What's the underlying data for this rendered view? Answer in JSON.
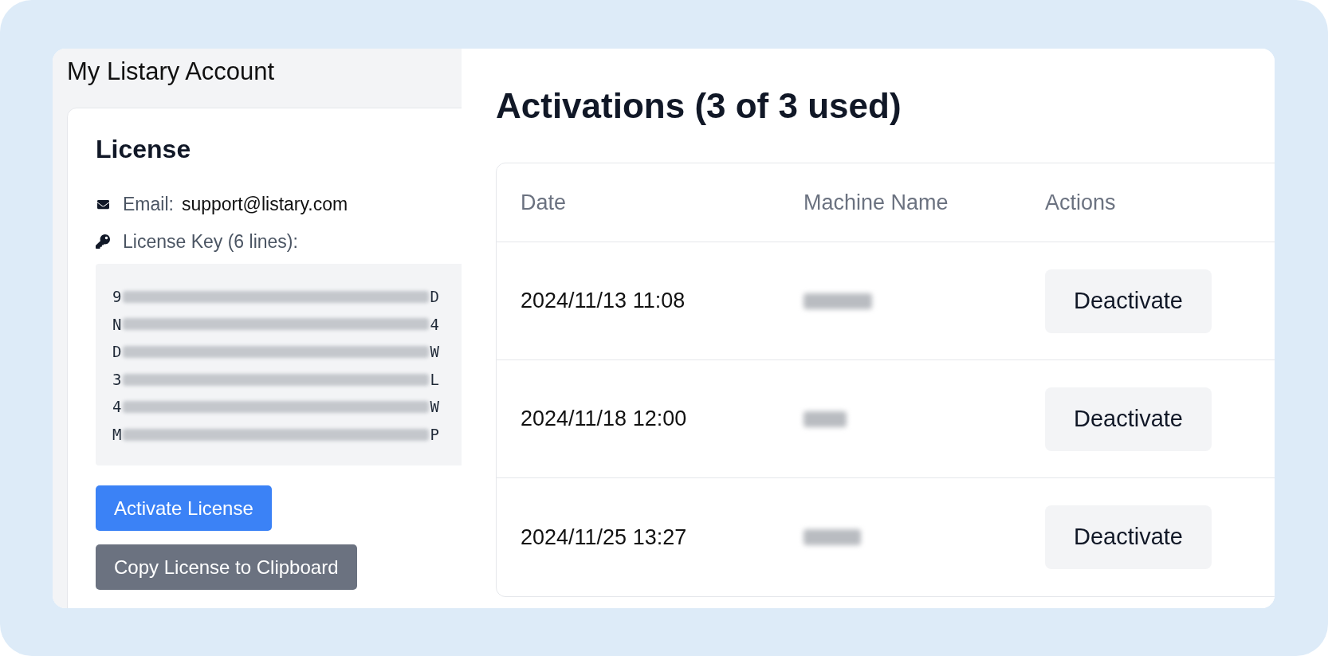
{
  "sidebar": {
    "title": "My Listary Account",
    "license_card": {
      "heading": "License",
      "email": {
        "label": "Email:",
        "value": "support@listary.com"
      },
      "key": {
        "label": "License Key (6 lines):",
        "lines": [
          {
            "first": "9",
            "last": "D"
          },
          {
            "first": "N",
            "last": "4"
          },
          {
            "first": "D",
            "last": "W"
          },
          {
            "first": "3",
            "last": "L"
          },
          {
            "first": "4",
            "last": "W"
          },
          {
            "first": "M",
            "last": "P"
          }
        ]
      },
      "buttons": [
        {
          "label": "Activate License",
          "kind": "primary"
        },
        {
          "label": "Copy License to Clipboard",
          "kind": "secondary"
        }
      ]
    }
  },
  "activations": {
    "heading": "Activations (3 of 3 used)",
    "table": {
      "columns": [
        "Date",
        "Machine Name",
        "Actions"
      ],
      "rows": [
        {
          "date": "2024/11/13 11:08",
          "action": "Deactivate"
        },
        {
          "date": "2024/11/18 12:00",
          "action": "Deactivate"
        },
        {
          "date": "2024/11/25 13:27",
          "action": "Deactivate"
        }
      ]
    }
  }
}
